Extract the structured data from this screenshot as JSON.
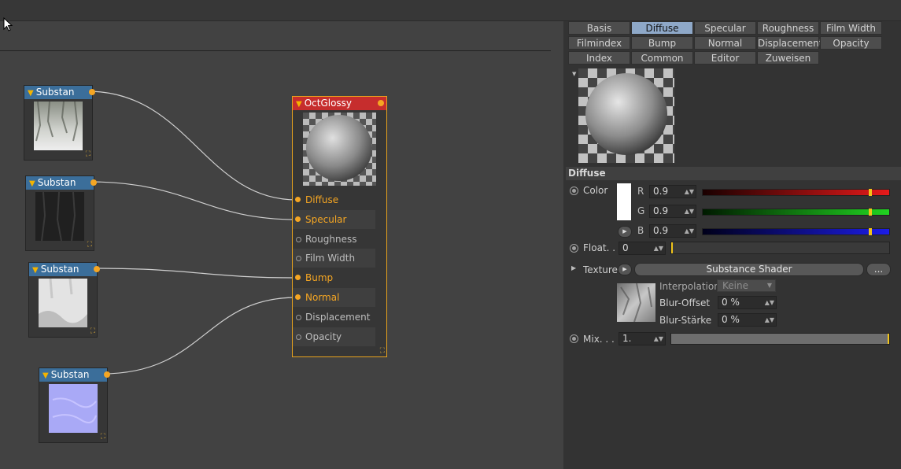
{
  "nodes": {
    "substance_labels": [
      "Substan",
      "Substan",
      "Substan",
      "Substan"
    ],
    "octglossy": {
      "title": "OctGlossy",
      "pins": [
        {
          "label": "Diffuse",
          "connected": true
        },
        {
          "label": "Specular",
          "connected": true
        },
        {
          "label": "Roughness",
          "connected": false
        },
        {
          "label": "Film Width",
          "connected": false
        },
        {
          "label": "Bump",
          "connected": true
        },
        {
          "label": "Normal",
          "connected": true
        },
        {
          "label": "Displacement",
          "connected": false
        },
        {
          "label": "Opacity",
          "connected": false
        }
      ]
    }
  },
  "tabs": [
    [
      "Basis",
      "Diffuse",
      "Specular",
      "Roughness",
      "Film Width"
    ],
    [
      "Filmindex",
      "Bump",
      "Normal",
      "Displacement",
      "Opacity"
    ],
    [
      "Index",
      "Common",
      "Editor",
      "Zuweisen"
    ]
  ],
  "active_tab": "Diffuse",
  "section_title": "Diffuse",
  "color": {
    "label": "Color",
    "r_label": "R",
    "r_value": "0.9",
    "g_label": "G",
    "g_value": "0.9",
    "b_label": "B",
    "b_value": "0.9",
    "r_level": 0.9,
    "g_level": 0.9,
    "b_level": 0.9
  },
  "float": {
    "label": "Float. .",
    "value": "0",
    "level": 0.0
  },
  "texture": {
    "label": "Texture",
    "shader_button": "Substance Shader",
    "more_button": "...",
    "interpolation_label": "Interpolation",
    "interpolation_value": "Keine",
    "blur_offset_label": "Blur-Offset",
    "blur_offset_value": "0 %",
    "blur_strength_label": "Blur-Stärke",
    "blur_strength_value": "0 %"
  },
  "mix": {
    "label": "Mix. . .",
    "value": "1.",
    "level": 1.0
  },
  "colors": {
    "node_header": "#3b6e9a",
    "octglossy_header": "#c62d2d",
    "pin_active": "#f5a623",
    "tab_active": "#8ea8c8"
  }
}
